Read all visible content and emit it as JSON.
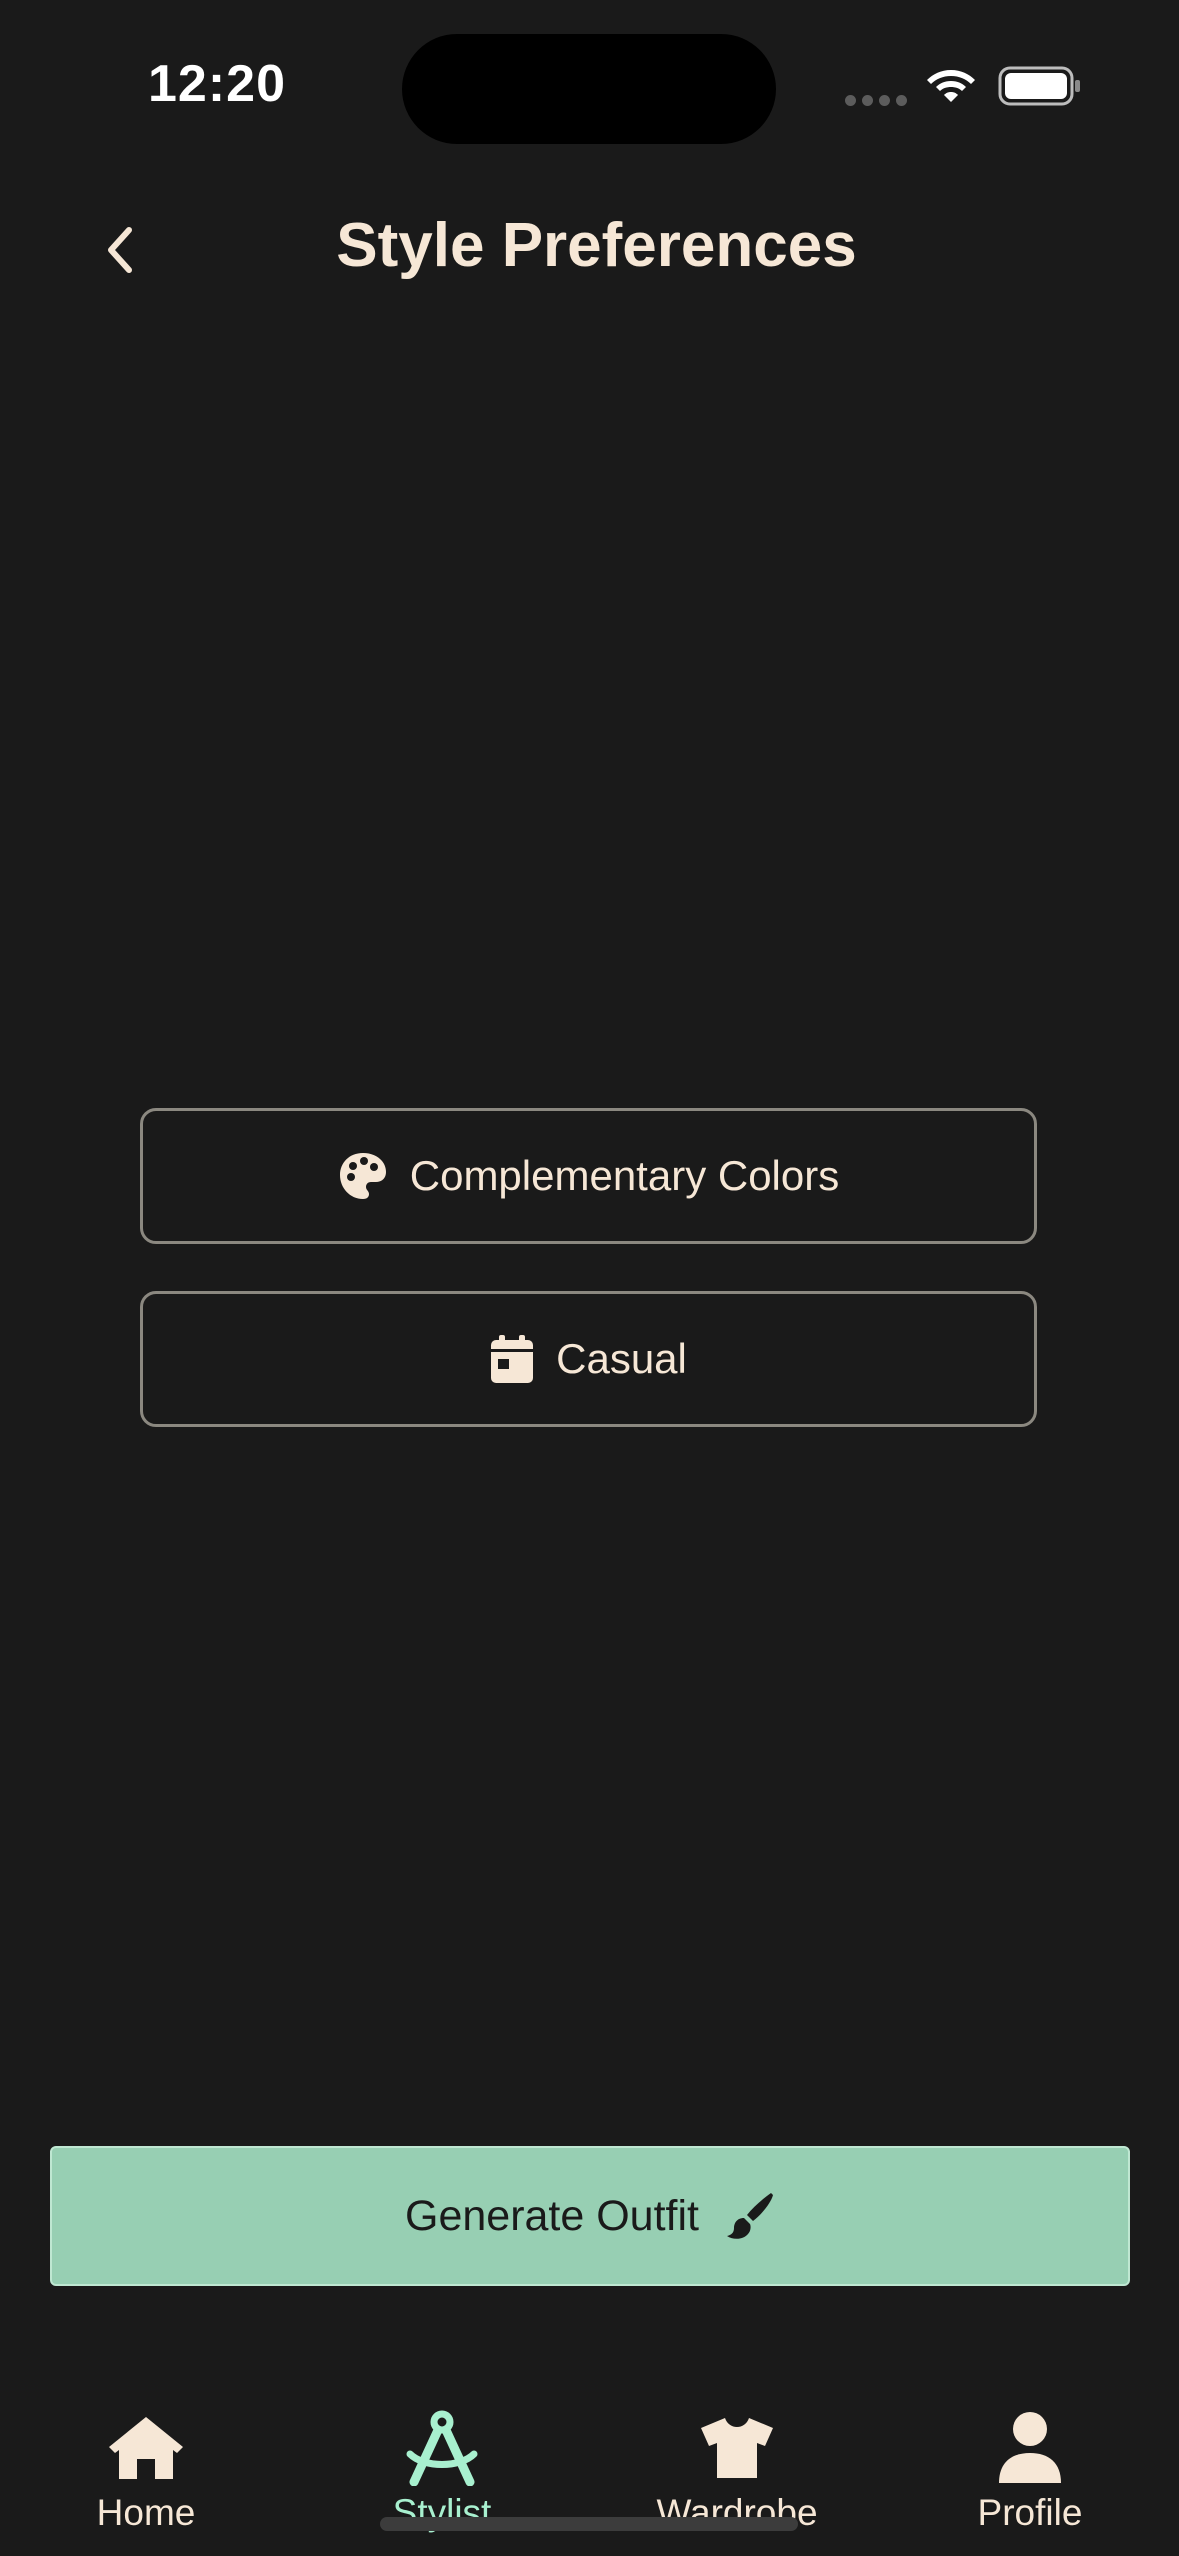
{
  "status_bar": {
    "time": "12:20"
  },
  "header": {
    "title": "Style Preferences",
    "back_icon": "chevron-left-icon"
  },
  "options": [
    {
      "label": "Complementary Colors",
      "icon": "palette-icon"
    },
    {
      "label": "Casual",
      "icon": "calendar-icon"
    }
  ],
  "generate": {
    "label": "Generate Outfit",
    "icon": "paintbrush-icon"
  },
  "tabs": [
    {
      "label": "Home",
      "icon": "home-icon",
      "active": false
    },
    {
      "label": "Stylist",
      "icon": "compass-drafting-icon",
      "active": true
    },
    {
      "label": "Wardrobe",
      "icon": "shirt-icon",
      "active": false
    },
    {
      "label": "Profile",
      "icon": "user-icon",
      "active": false
    }
  ],
  "colors": {
    "background": "#1a1a1a",
    "text": "#f6e7d6",
    "accent": "#97cfb3",
    "active_tab": "#a8f0cf"
  }
}
